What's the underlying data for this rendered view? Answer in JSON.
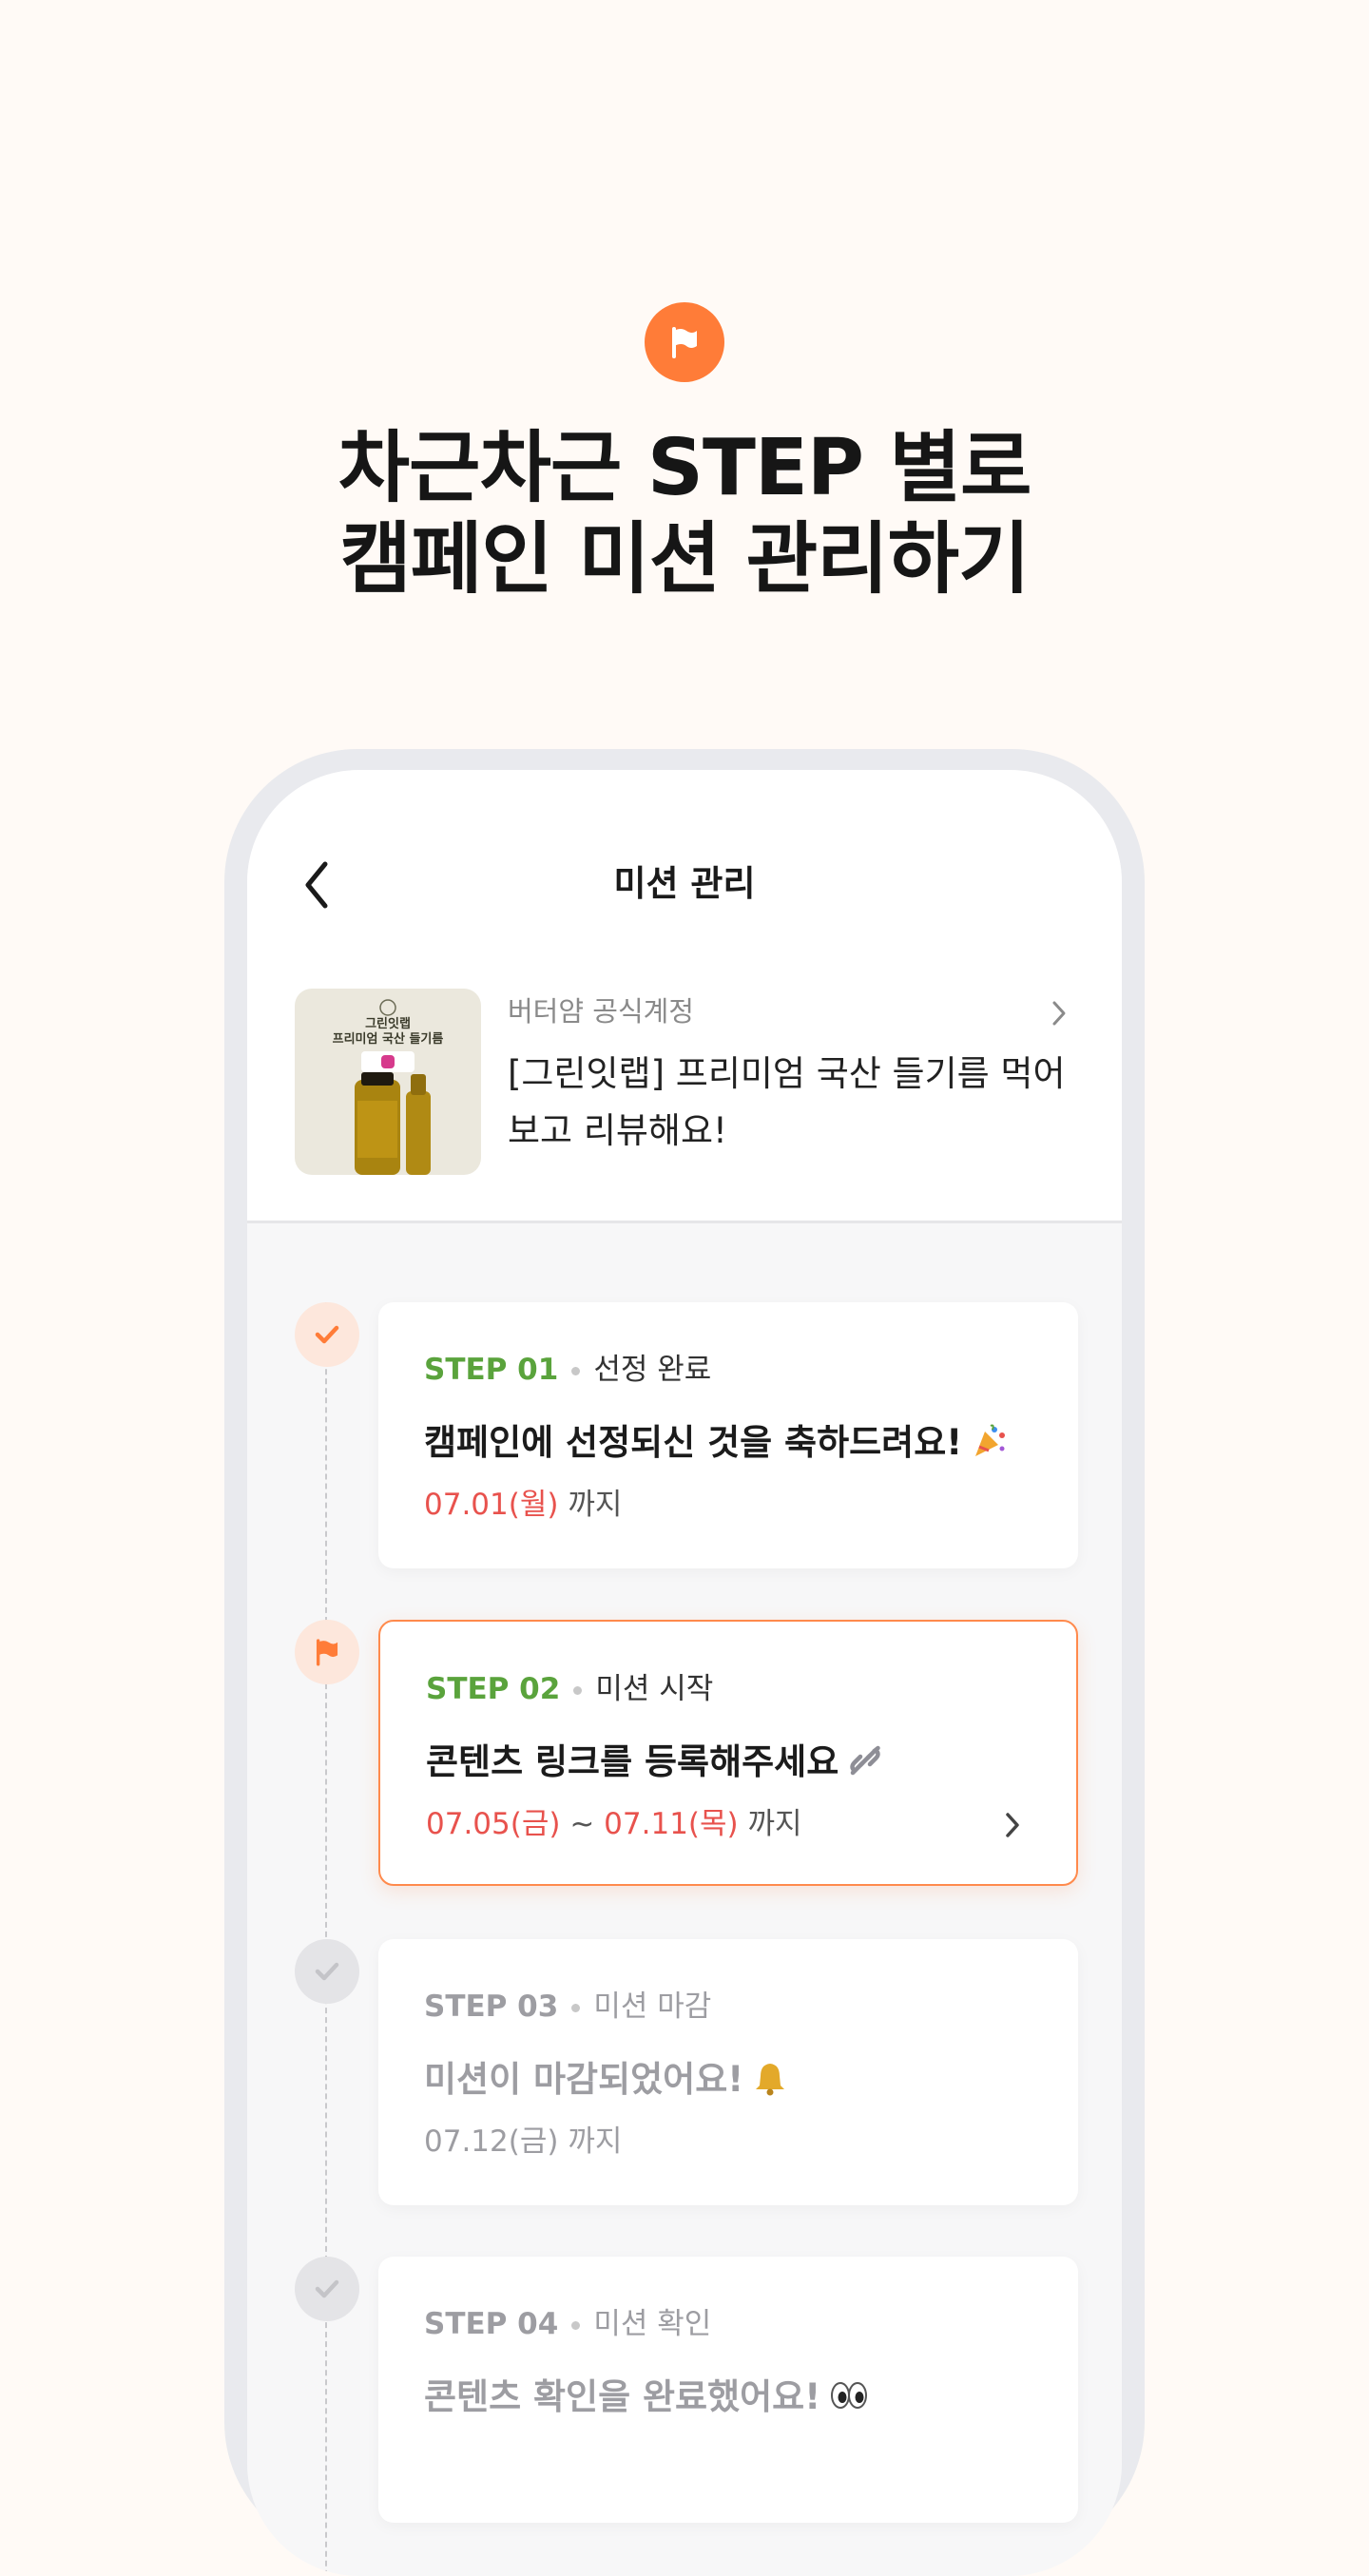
{
  "headline": {
    "line1": "차근차근 STEP 별로",
    "line2": "캠페인 미션 관리하기"
  },
  "header": {
    "title": "미션 관리"
  },
  "campaign": {
    "thumbnail_title_line1": "그린잇랩",
    "thumbnail_title_line2": "프리미엄 국산 들기름",
    "account": "버터얌 공식계정",
    "title": "[그린잇랩] 프리미엄 국산 들기름 먹어보고 리뷰해요!"
  },
  "steps": [
    {
      "label": "STEP 01",
      "status": "선정 완료",
      "title": "캠페인에 선정되신 것을 축하드려요!",
      "icon": "party-popper-icon",
      "date_start": "07.01(월)",
      "date_sep": "",
      "date_end": "",
      "suffix": "까지",
      "state": "done"
    },
    {
      "label": "STEP 02",
      "status": "미션 시작",
      "title": "콘텐츠 링크를 등록해주세요",
      "icon": "link-icon",
      "date_start": "07.05(금)",
      "date_sep": "~",
      "date_end": "07.11(목)",
      "suffix": "까지",
      "state": "current"
    },
    {
      "label": "STEP 03",
      "status": "미션 마감",
      "title": "미션이 마감되었어요!",
      "icon": "bell-icon",
      "date_start": "07.12(금)",
      "date_sep": "",
      "date_end": "",
      "suffix": "까지",
      "state": "upcoming"
    },
    {
      "label": "STEP 04",
      "status": "미션 확인",
      "title": "콘텐츠 확인을 완료했어요!",
      "icon": "eyes-icon",
      "date_start": "",
      "date_sep": "",
      "date_end": "",
      "suffix": "",
      "state": "upcoming"
    }
  ],
  "colors": {
    "accent": "#ff7c38",
    "step_green": "#5aa33c",
    "date_red": "#e8524d",
    "background": "#fffaf6"
  }
}
